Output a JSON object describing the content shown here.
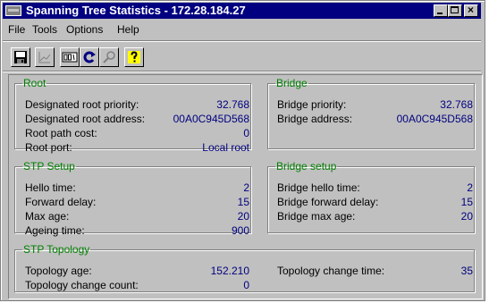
{
  "window": {
    "title": "Spanning Tree Statistics - 172.28.184.27",
    "minimize_icon": "minimize-icon",
    "maximize_icon": "maximize-icon",
    "close_icon": "close-icon",
    "close_glyph": "×"
  },
  "menu": {
    "file": "File",
    "tools": "Tools",
    "options": "Options",
    "help": "Help"
  },
  "toolbar": {
    "icons": [
      "save-icon",
      "graph-icon",
      "reset-counter-icon",
      "refresh-icon",
      "find-icon",
      "help-icon"
    ]
  },
  "root": {
    "title": "Root",
    "rows": [
      {
        "label": "Designated root priority:",
        "value": "32.768"
      },
      {
        "label": "Designated root address:",
        "value": "00A0C945D568"
      },
      {
        "label": "Root path cost:",
        "value": "0"
      },
      {
        "label": "Root port:",
        "value": "Local root"
      }
    ]
  },
  "bridge": {
    "title": "Bridge",
    "rows": [
      {
        "label": "Bridge priority:",
        "value": "32.768"
      },
      {
        "label": "Bridge address:",
        "value": "00A0C945D568"
      }
    ]
  },
  "stp_setup": {
    "title": "STP Setup",
    "rows": [
      {
        "label": "Hello time:",
        "value": "2"
      },
      {
        "label": "Forward delay:",
        "value": "15"
      },
      {
        "label": "Max age:",
        "value": "20"
      },
      {
        "label": "Ageing time:",
        "value": "900"
      }
    ]
  },
  "bridge_setup": {
    "title": "Bridge setup",
    "rows": [
      {
        "label": "Bridge hello time:",
        "value": "2"
      },
      {
        "label": "Bridge forward delay:",
        "value": "15"
      },
      {
        "label": "Bridge max age:",
        "value": "20"
      }
    ]
  },
  "stp_topology": {
    "title": "STP Topology",
    "topology_age_label": "Topology age:",
    "topology_age_value": "152.210",
    "change_count_label": "Topology change count:",
    "change_count_value": "0",
    "change_time_label": "Topology change time:",
    "change_time_value": "35"
  },
  "colors": {
    "titlebar": "#000080",
    "value_text": "#000080",
    "group_title": "#008000",
    "face": "#c0c0c0"
  }
}
